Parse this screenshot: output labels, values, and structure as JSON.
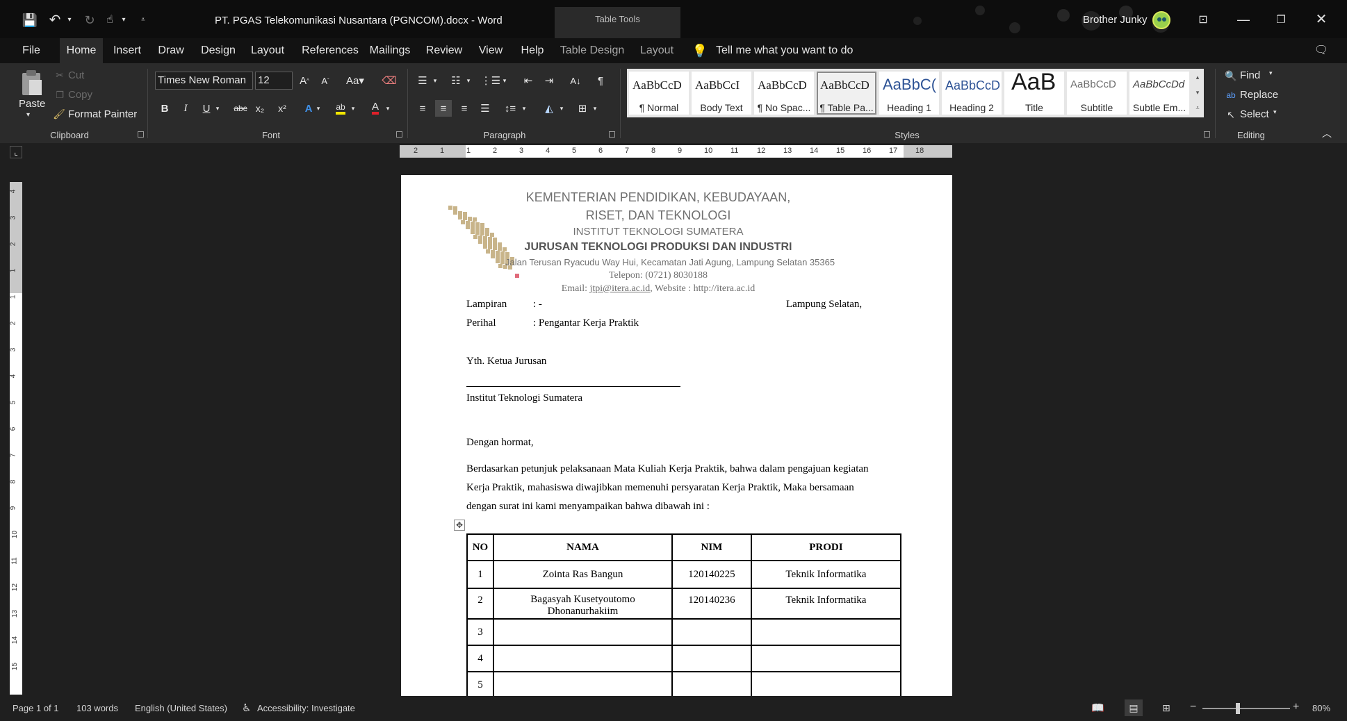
{
  "title_bar": {
    "doc_title": "PT. PGAS Telekomunikasi Nusantara (PGNCOM).docx  -  Word",
    "contextual_title": "Table Tools",
    "user_name": "Brother Junky"
  },
  "tabs": [
    "File",
    "Home",
    "Insert",
    "Draw",
    "Design",
    "Layout",
    "References",
    "Mailings",
    "Review",
    "View",
    "Help",
    "Table Design",
    "Layout"
  ],
  "tell_me": "Tell me what you want to do",
  "clipboard": {
    "paste": "Paste",
    "cut": "Cut",
    "copy": "Copy",
    "format_painter": "Format Painter",
    "group": "Clipboard"
  },
  "font": {
    "name": "Times New Roman",
    "size": "12",
    "group": "Font"
  },
  "paragraph": {
    "group": "Paragraph"
  },
  "styles": {
    "group": "Styles",
    "items": [
      {
        "preview": "AaBbCcD",
        "name": "¶ Normal"
      },
      {
        "preview": "AaBbCcI",
        "name": "Body Text"
      },
      {
        "preview": "AaBbCcD",
        "name": "¶ No Spac..."
      },
      {
        "preview": "AaBbCcD",
        "name": "¶ Table Pa..."
      },
      {
        "preview": "AaBbC(",
        "name": "Heading 1"
      },
      {
        "preview": "AaBbCcD",
        "name": "Heading 2"
      },
      {
        "preview": "AaB",
        "name": "Title"
      },
      {
        "preview": "AaBbCcD",
        "name": "Subtitle"
      },
      {
        "preview": "AaBbCcDd",
        "name": "Subtle Em..."
      }
    ]
  },
  "editing": {
    "find": "Find",
    "replace": "Replace",
    "select": "Select",
    "group": "Editing"
  },
  "ruler": {
    "h_ticks": [
      "2",
      "1",
      "1",
      "2",
      "3",
      "4",
      "5",
      "6",
      "7",
      "8",
      "9",
      "10",
      "11",
      "12",
      "13",
      "14",
      "15",
      "16",
      "17",
      "18"
    ],
    "v_ticks": [
      "4",
      "3",
      "2",
      "1",
      "1",
      "2",
      "3",
      "4",
      "5",
      "6",
      "7",
      "8",
      "9",
      "10",
      "11",
      "12",
      "13",
      "14",
      "15"
    ]
  },
  "document": {
    "letterhead": [
      "KEMENTERIAN PENDIDIKAN, KEBUDAYAAN,",
      "RISET, DAN TEKNOLOGI",
      "INSTITUT TEKNOLOGI SUMATERA",
      "JURUSAN TEKNOLOGI PRODUKSI DAN INDUSTRI",
      "Jalan Terusan Ryacudu Way Hui, Kecamatan Jati Agung, Lampung Selatan 35365",
      "Telepon: (0721) 8030188"
    ],
    "email_label": "Email: ",
    "email": "jtpi@itera.ac.id",
    "website": ", Website : http://itera.ac.id",
    "lampiran_label": "Lampiran",
    "lampiran_value": ": -",
    "place_date": "Lampung Selatan,",
    "perihal_label": "Perihal",
    "perihal_value": ": Pengantar Kerja Praktik",
    "addressee": "Yth. Ketua Jurusan",
    "institution": "Institut Teknologi Sumatera",
    "salutation": "Dengan hormat,",
    "paragraph_lines": [
      "Berdasarkan petunjuk pelaksanaan Mata Kuliah Kerja Praktik, bahwa dalam  pengajuan kegiatan",
      "Kerja Praktik, mahasiswa diwajibkan memenuhi persyaratan Kerja Praktik, Maka bersamaan",
      "dengan surat ini kami menyampaikan bahwa dibawah ini :"
    ],
    "table": {
      "headers": [
        "NO",
        "NAMA",
        "NIM",
        "PRODI"
      ],
      "rows": [
        {
          "no": "1",
          "nama": "Zointa Ras Bangun",
          "nama2": "",
          "nim": "120140225",
          "prodi": "Teknik Informatika"
        },
        {
          "no": "2",
          "nama": "Bagasyah Kusetyoutomo",
          "nama2": "Dhonanurhakiim",
          "nim": "120140236",
          "prodi": "Teknik Informatika"
        },
        {
          "no": "3",
          "nama": "",
          "nama2": "",
          "nim": "",
          "prodi": ""
        },
        {
          "no": "4",
          "nama": "",
          "nama2": "",
          "nim": "",
          "prodi": ""
        },
        {
          "no": "5",
          "nama": "",
          "nama2": "",
          "nim": "",
          "prodi": ""
        }
      ]
    }
  },
  "status": {
    "page": "Page 1 of 1",
    "words": "103 words",
    "language": "English (United States)",
    "accessibility": "Accessibility: Investigate",
    "zoom": "80%"
  },
  "colors": {
    "accent": "#c8b48a",
    "title_bar": "#0d0d0d",
    "ribbon": "#2b2b2b",
    "canvas": "#1f1f1f"
  }
}
